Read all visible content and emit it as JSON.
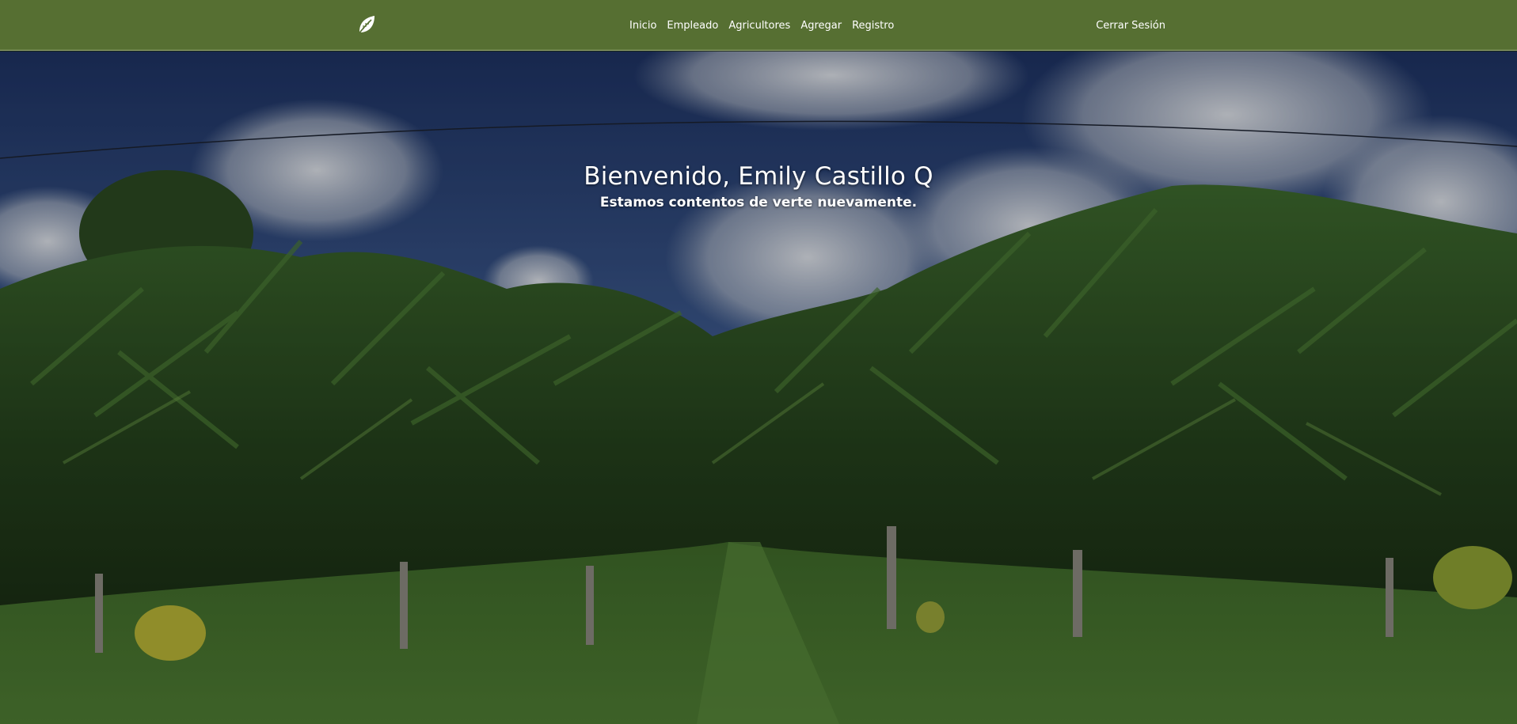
{
  "nav": {
    "logo_icon": "leaf-icon",
    "links": [
      "Inicio",
      "Empleado",
      "Agricultores",
      "Agregar",
      "Registro"
    ],
    "logout_label": "Cerrar Sesión"
  },
  "hero": {
    "title": "Bienvenido, Emily Castillo Q",
    "subtitle": "Estamos contentos de verte nuevamente.",
    "background": "banana-plantation-photo"
  },
  "colors": {
    "navbar": "#566f32",
    "text": "#ffffff"
  }
}
